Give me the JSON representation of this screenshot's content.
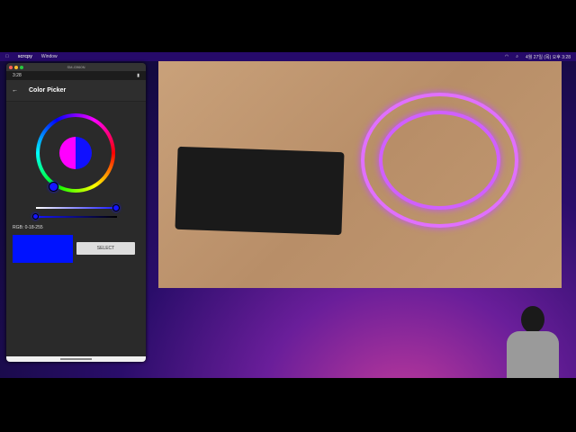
{
  "menubar": {
    "app": "scrcpy",
    "menu": "Window",
    "clock": "4월 27일 (목) 오후 3:28"
  },
  "window": {
    "title": "SM-G960N"
  },
  "status_bar": {
    "time": "3:28"
  },
  "app_bar": {
    "title": "Color Picker",
    "back_icon": "arrow-left-icon"
  },
  "picker": {
    "rgb_label": "RGB: 0-18-255",
    "swatch_color": "#0012ff",
    "select_label": "SELECT",
    "saturation": 1.0,
    "value": 0.0
  },
  "camera": {
    "description_icon": "webcam-feed"
  }
}
